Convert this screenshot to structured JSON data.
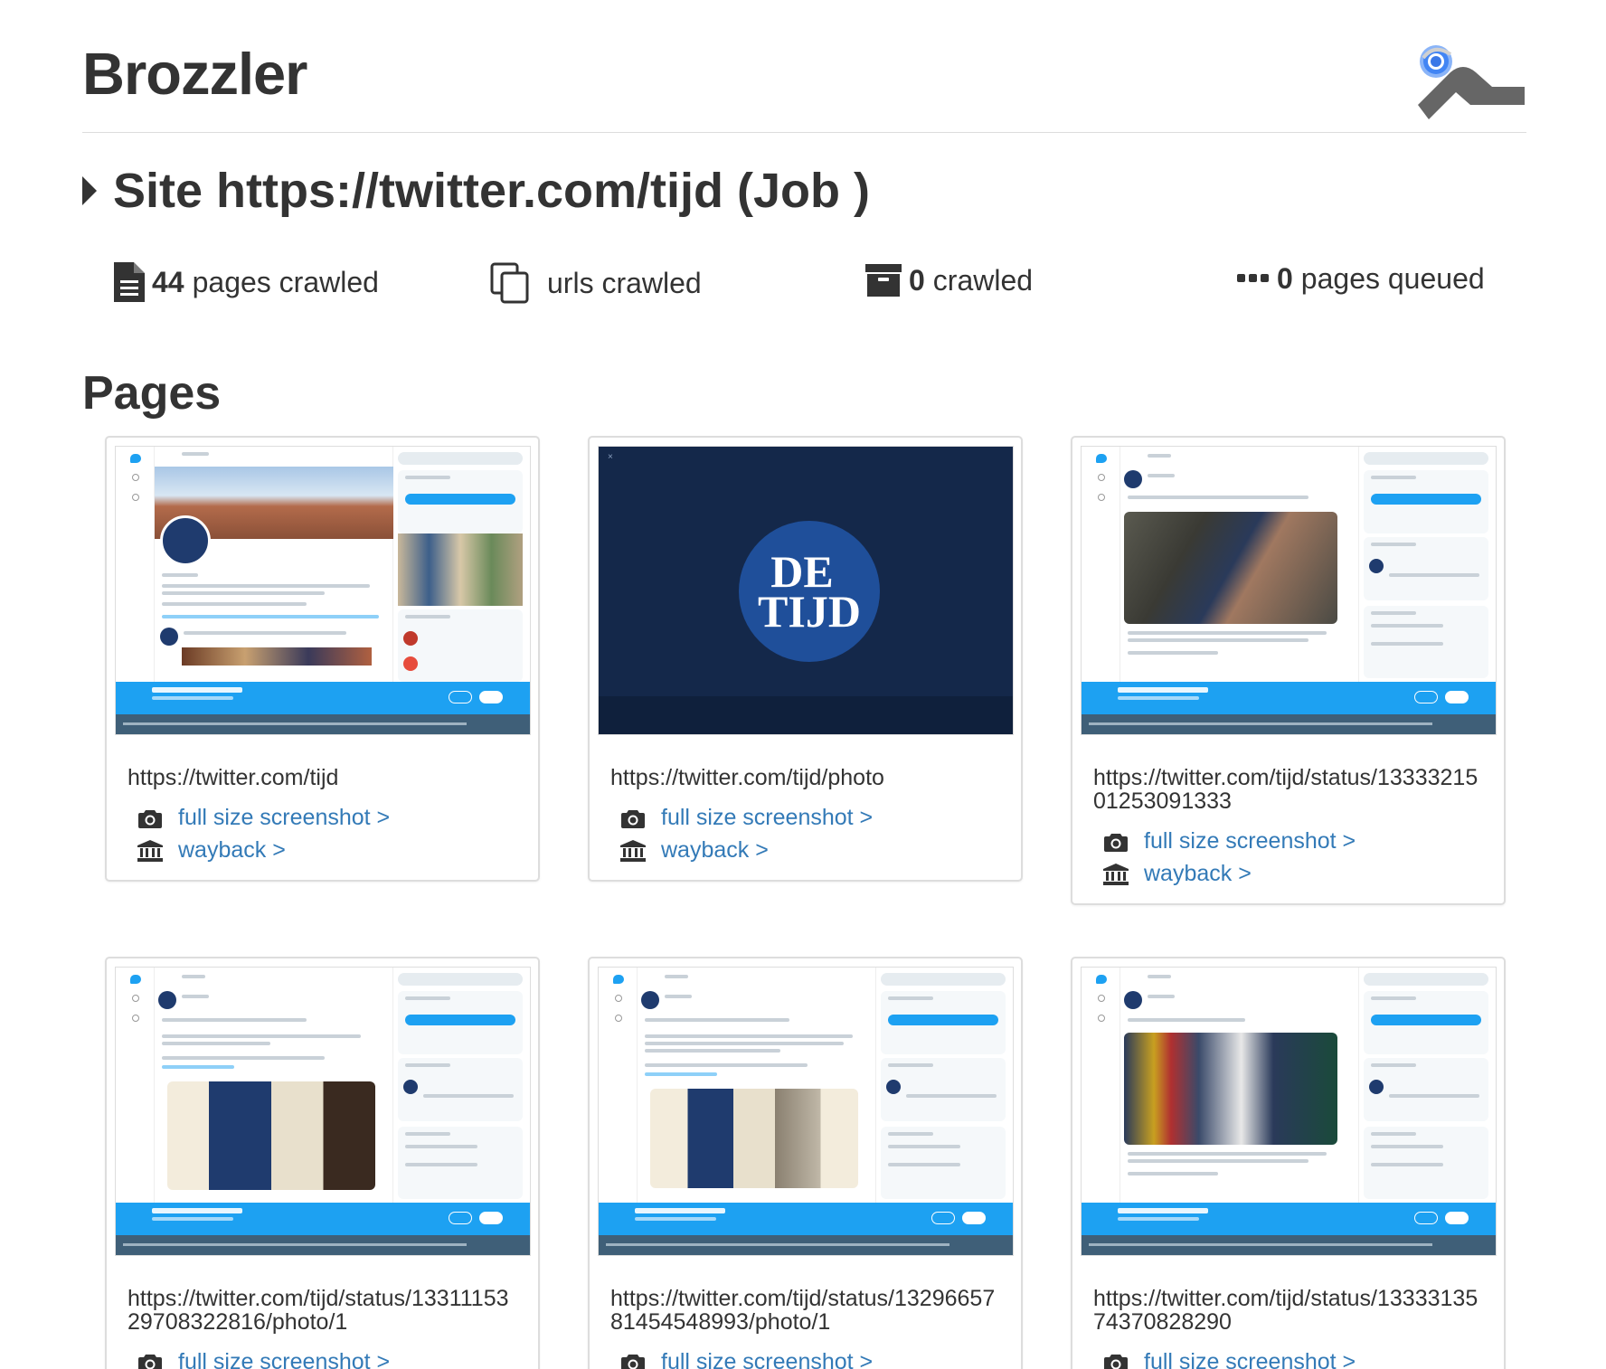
{
  "app": {
    "title": "Brozzler",
    "logo_icon": "brozzler-logo-icon"
  },
  "site": {
    "heading": "Site https://twitter.com/tijd (Job )",
    "toggle_icon": "caret-right-icon"
  },
  "stats": {
    "pages_crawled": {
      "count": "44",
      "label": "pages crawled",
      "icon": "document-icon"
    },
    "urls_crawled": {
      "count": "",
      "label": "urls crawled",
      "icon": "copy-icon"
    },
    "crawled": {
      "count": "0",
      "label": "crawled",
      "icon": "archive-icon"
    },
    "pages_queued": {
      "count": "0",
      "label": "pages queued",
      "icon": "ellipsis-icon"
    }
  },
  "pages_section": {
    "heading": "Pages"
  },
  "links": {
    "screenshot_label": "full size screenshot >",
    "wayback_label": "wayback >",
    "screenshot_icon": "camera-icon",
    "wayback_icon": "institution-icon"
  },
  "pages": [
    {
      "url": "https://twitter.com/tijd",
      "thumb": "profile"
    },
    {
      "url": "https://twitter.com/tijd/photo",
      "thumb": "photo"
    },
    {
      "url": "https://twitter.com/tijd/status/1333321501253091333",
      "thumb": "tweet-person"
    },
    {
      "url": "https://twitter.com/tijd/status/1331115329708322816/photo/1",
      "thumb": "tweet-newspaper"
    },
    {
      "url": "https://twitter.com/tijd/status/1329665781454548993/photo/1",
      "thumb": "tweet-newspaper2"
    },
    {
      "url": "https://twitter.com/tijd/status/1333313574370828290",
      "thumb": "tweet-stage"
    }
  ],
  "colors": {
    "link": "#337ab7",
    "twitter_blue": "#1da1f2",
    "tijd_navy": "#1f3b6e",
    "photo_bg": "#14284a"
  }
}
